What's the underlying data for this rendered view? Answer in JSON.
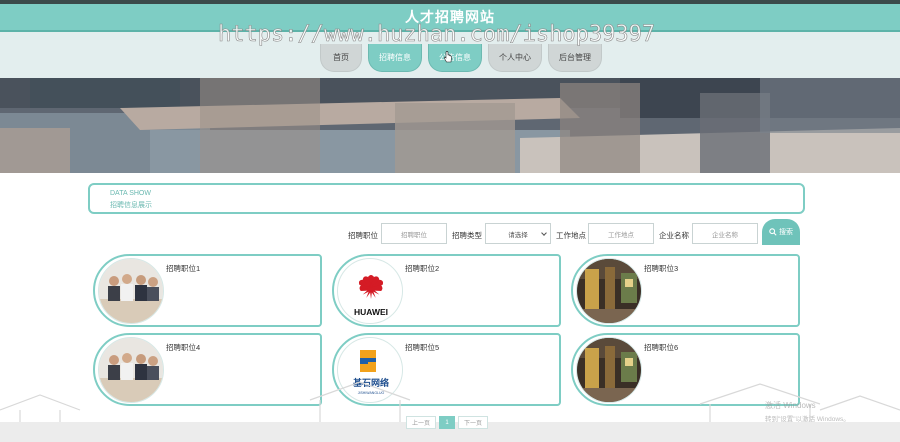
{
  "header": {
    "site_title": "人才招聘网站",
    "watermark": "https://www.huzhan.com/ishop39397"
  },
  "nav": {
    "items": [
      {
        "label": "首页",
        "active": false
      },
      {
        "label": "招聘信息",
        "active": true
      },
      {
        "label": "公告信息",
        "active": true
      },
      {
        "label": "个人中心",
        "active": false
      },
      {
        "label": "后台管理",
        "active": false
      }
    ]
  },
  "section": {
    "title_en": "DATA SHOW",
    "title_cn": "招聘信息展示"
  },
  "search": {
    "position_label": "招聘职位",
    "position_placeholder": "招聘职位",
    "type_label": "招聘类型",
    "type_selected": "请选择",
    "location_label": "工作地点",
    "location_placeholder": "工作地点",
    "company_label": "企业名称",
    "company_placeholder": "企业名称",
    "button_label": "搜索"
  },
  "jobs": [
    {
      "title": "招聘职位1",
      "image": "meeting-photo"
    },
    {
      "title": "招聘职位2",
      "image": "huawei-logo"
    },
    {
      "title": "招聘职位3",
      "image": "office-photo"
    },
    {
      "title": "招聘职位4",
      "image": "meeting-photo"
    },
    {
      "title": "招聘职位5",
      "image": "jishi-logo"
    },
    {
      "title": "招聘职位6",
      "image": "office-photo"
    }
  ],
  "logos": {
    "huawei_text": "HUAWEI",
    "jishi_cn": "基石网络",
    "jishi_en": "JISHIWANGLUO"
  },
  "pagination": {
    "prev": "上一页",
    "current": "1",
    "next": "下一页"
  },
  "os_notice": {
    "line1": "激活 Windows",
    "line2": "转到\"设置\"以激活 Windows。"
  },
  "colors": {
    "accent": "#7ecdc4",
    "accent_dark": "#5db3a9"
  }
}
